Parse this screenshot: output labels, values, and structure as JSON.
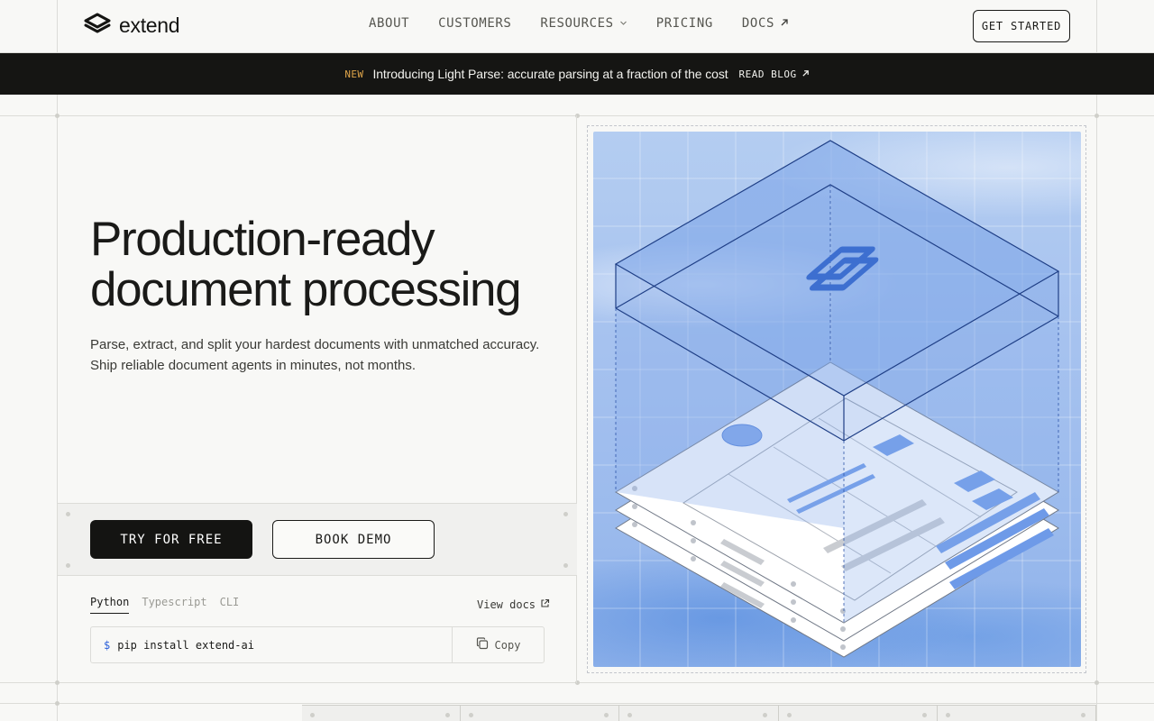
{
  "brand": {
    "name": "extend"
  },
  "nav": {
    "items": [
      {
        "label": "ABOUT"
      },
      {
        "label": "CUSTOMERS"
      },
      {
        "label": "RESOURCES",
        "icon": "chevron-down-icon"
      },
      {
        "label": "PRICING"
      },
      {
        "label": "DOCS",
        "icon": "arrow-up-right-icon"
      }
    ],
    "cta": "GET STARTED"
  },
  "announcement": {
    "tag": "NEW",
    "message": "Introducing Light Parse: accurate parsing at a fraction of the cost",
    "link": "READ BLOG"
  },
  "hero": {
    "title_line1": "Production-ready",
    "title_line2": "document processing",
    "subtitle": "Parse, extract, and split your hardest documents with unmatched accuracy. Ship reliable document agents in minutes, not months.",
    "primary_button": "TRY FOR FREE",
    "secondary_button": "BOOK DEMO"
  },
  "install": {
    "tabs": [
      {
        "label": "Python",
        "active": true
      },
      {
        "label": "Typescript",
        "active": false
      },
      {
        "label": "CLI",
        "active": false
      }
    ],
    "view_docs": "View docs",
    "prompt": "$",
    "command": "pip install extend-ai",
    "copy_label": "Copy"
  },
  "colors": {
    "accent": "#2b5fd9",
    "banner_bg": "#151513",
    "new_tag": "#e0a64a",
    "hero_art_bg": "#a6c2ef"
  }
}
